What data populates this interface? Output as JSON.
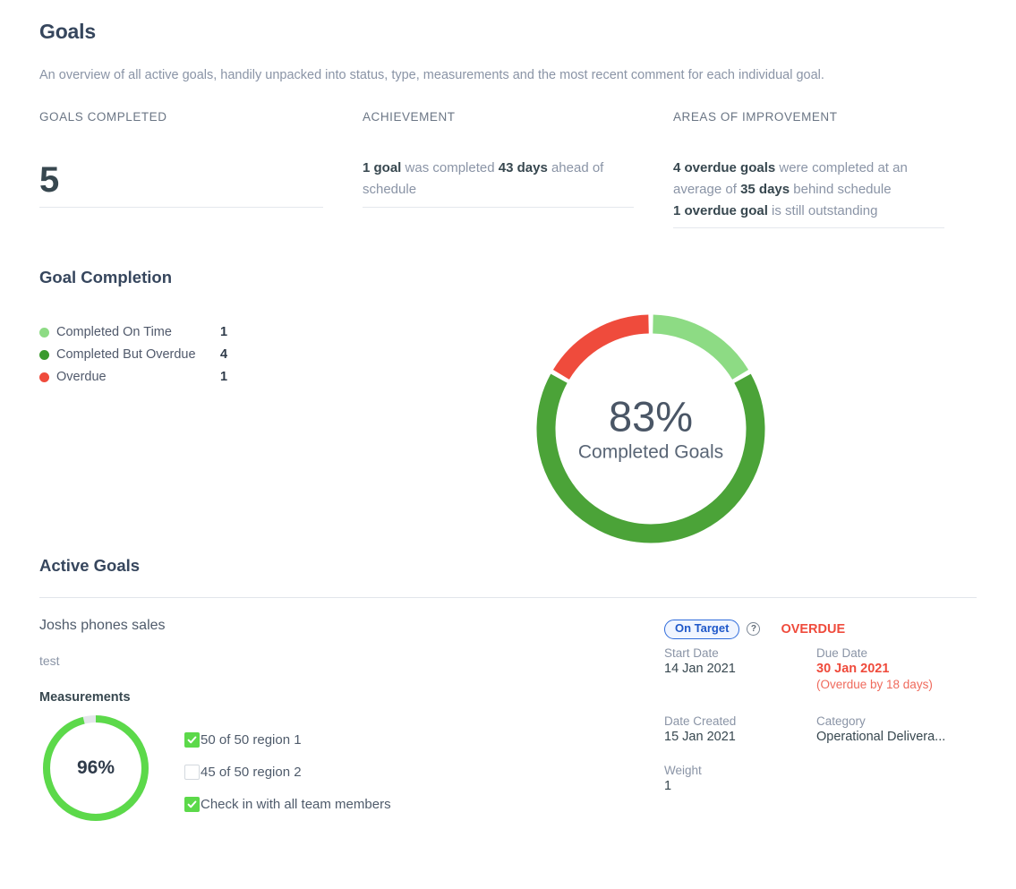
{
  "header": {
    "title": "Goals",
    "subtitle": "An overview of all active goals, handily unpacked into status, type, measurements and the most recent comment for each individual goal."
  },
  "stats": [
    {
      "label": "GOALS COMPLETED",
      "value": "5"
    },
    {
      "label": "ACHIEVEMENT",
      "text_parts": [
        "1 goal",
        " was completed ",
        "43 days",
        " ahead of schedule"
      ]
    },
    {
      "label": "AREAS OF IMPROVEMENT",
      "line1": [
        "4 overdue goals",
        " were completed at an average of ",
        "35 days",
        " behind schedule"
      ],
      "line2": [
        "1 overdue goal",
        " is still outstanding"
      ]
    }
  ],
  "goal_completion": {
    "title": "Goal Completion",
    "legend": [
      {
        "label": "Completed On Time",
        "value": "1",
        "color": "#8ddb84"
      },
      {
        "label": "Completed But Overdue",
        "value": "4",
        "color": "#3a9a2e"
      },
      {
        "label": "Overdue",
        "value": "1",
        "color": "#ef4b3c"
      }
    ],
    "center_percent": "83%",
    "center_caption": "Completed Goals"
  },
  "chart_data": {
    "type": "pie",
    "title": "Goal Completion",
    "categories": [
      "Completed On Time",
      "Completed But Overdue",
      "Overdue"
    ],
    "values": [
      1,
      4,
      1
    ],
    "colors": [
      "#8ddb84",
      "#4ba338",
      "#ef4b3c"
    ],
    "total": 6,
    "center_label": "83%",
    "center_sublabel": "Completed Goals",
    "legend_position": "left",
    "donut": true
  },
  "active_goals": {
    "title": "Active Goals",
    "items": [
      {
        "name": "Joshs phones sales",
        "description": "test",
        "measurements_title": "Measurements",
        "gauge": {
          "percent_label": "96%",
          "percent_value": 96,
          "color": "#5cd94a",
          "track_color": "#e3e6ea"
        },
        "measures": [
          {
            "checked": true,
            "label": "50 of 50 region 1"
          },
          {
            "checked": false,
            "label": "45 of 50 region 2"
          },
          {
            "checked": true,
            "label": "Check in with all team members"
          }
        ],
        "status_badge": "On Target",
        "help_icon_glyph": "?",
        "overdue_flag": "OVERDUE",
        "fields": {
          "start_date_label": "Start Date",
          "start_date_value": "14 Jan 2021",
          "due_date_label": "Due Date",
          "due_date_value": "30 Jan 2021",
          "due_date_note": "(Overdue by 18 days)",
          "date_created_label": "Date Created",
          "date_created_value": "15 Jan 2021",
          "category_label": "Category",
          "category_value": "Operational Delivera...",
          "weight_label": "Weight",
          "weight_value": "1"
        }
      }
    ]
  }
}
